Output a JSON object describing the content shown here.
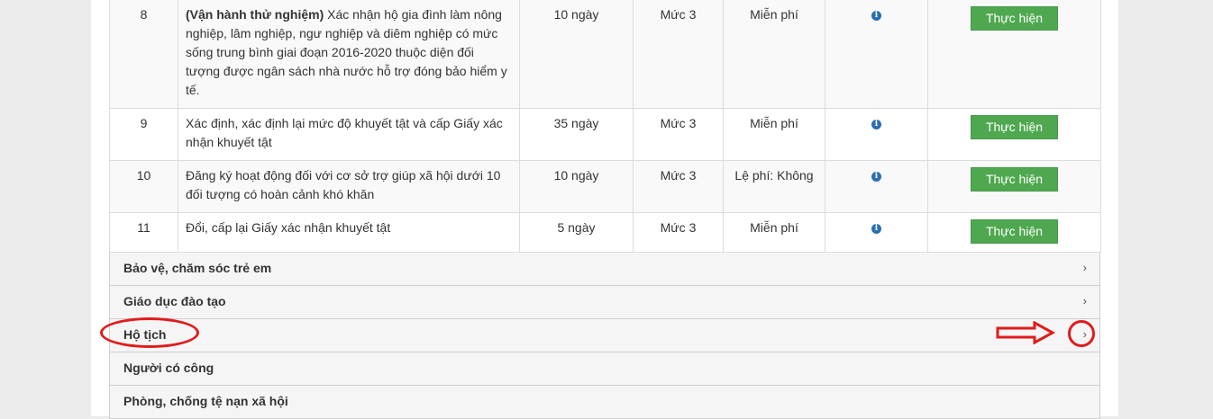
{
  "rows": [
    {
      "num": "8",
      "tag": "(Vận hành thử nghiệm)",
      "name_line1_rest": " Xác nhận hộ gia đình làm nông",
      "name_lines": [
        "nghiệp, lâm nghiệp, ngư nghiệp và diêm nghiệp có mức",
        "sống trung bình giai đoạn 2016-2020 thuộc diện đối",
        "tượng được ngân sách nhà nước hỗ trợ đóng bảo hiểm y",
        "tế."
      ],
      "days": "10 ngày",
      "level": "Mức  3",
      "fee": "Miễn phí",
      "action": "Thực hiện"
    },
    {
      "num": "9",
      "name_lines": [
        "Xác định, xác định lại mức độ khuyết tật và cấp Giấy xác",
        "nhận khuyết tật"
      ],
      "days": "35 ngày",
      "level": "Mức  3",
      "fee": "Miễn phí",
      "action": "Thực hiện"
    },
    {
      "num": "10",
      "name_lines": [
        "Đăng ký hoạt động đối với cơ sở trợ giúp xã hội dưới 10",
        "đối tượng có hoàn cảnh khó khăn"
      ],
      "days": "10 ngày",
      "level": "Mức  3",
      "fee": "Lệ phí: Không",
      "action": "Thực hiện"
    },
    {
      "num": "11",
      "name_lines": [
        "Đổi, cấp lại Giấy xác nhận khuyết tật"
      ],
      "days": "5 ngày",
      "level": "Mức  3",
      "fee": "Miễn phí",
      "action": "Thực hiện"
    }
  ],
  "categories": [
    {
      "label": "Bảo vệ, chăm sóc trẻ em"
    },
    {
      "label": "Giáo dục đào tạo"
    },
    {
      "label": "Hộ tịch"
    },
    {
      "label": "Người có công"
    },
    {
      "label": "Phòng, chống tệ nạn xã hội"
    }
  ],
  "icons": {
    "info": "info-icon",
    "chevron": "chevron-right-icon",
    "info_glyph": "i",
    "chevron_glyph": "›"
  },
  "colors": {
    "action_button": "#4fa84f",
    "level_text": "#d0212b",
    "annotation": "#e01c1c",
    "info_icon": "#2a6db5"
  }
}
